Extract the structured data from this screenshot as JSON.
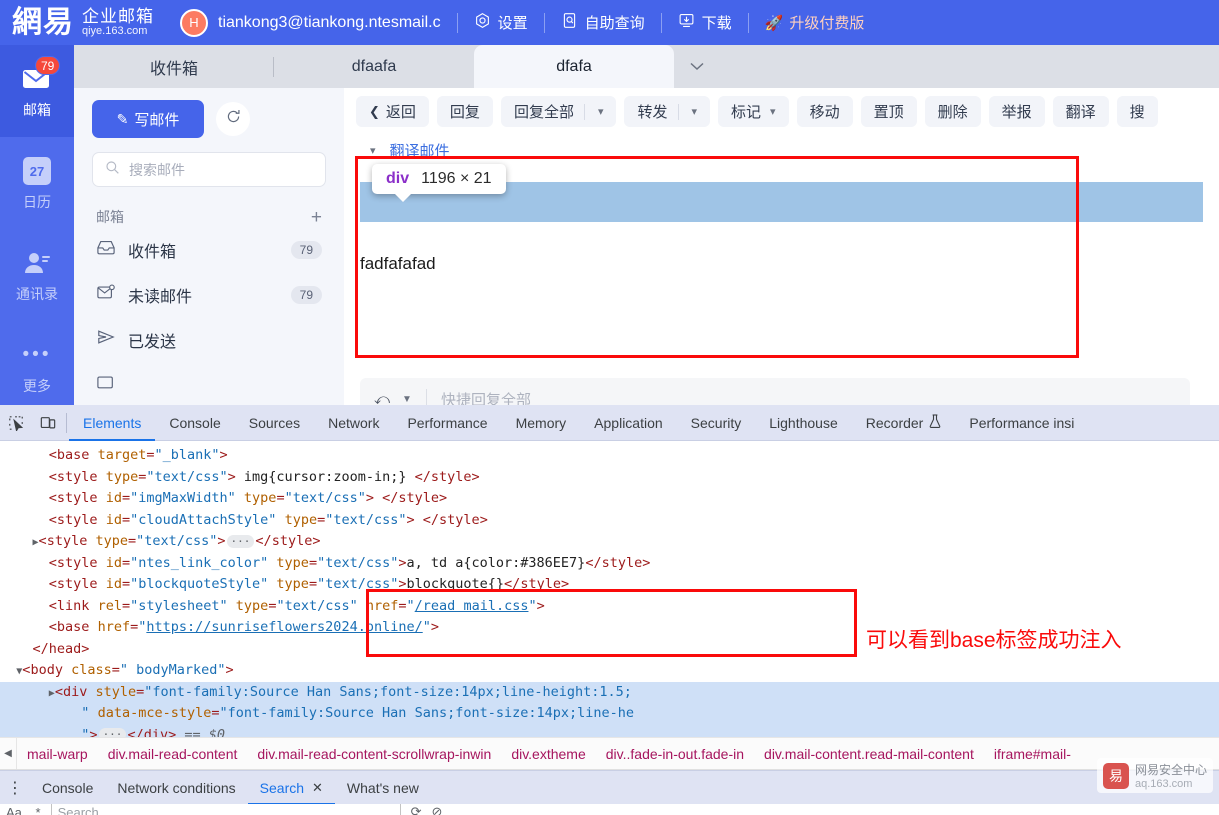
{
  "topbar": {
    "logo": "網易",
    "brand_line1": "企业邮箱",
    "brand_line2": "qiye.163.com",
    "avatar_initial": "H",
    "account": "tiankong3@tiankong.ntesmail.c",
    "items": [
      {
        "icon": "gear-icon",
        "label": "设置"
      },
      {
        "icon": "self-service-icon",
        "label": "自助查询"
      },
      {
        "icon": "download-icon",
        "label": "下载"
      },
      {
        "icon": "rocket-icon",
        "label": "升级付费版"
      }
    ],
    "accent": "#4564ea",
    "upgrade_color": "#ffd0bf"
  },
  "rail": {
    "items": [
      {
        "label": "邮箱",
        "badge": "79",
        "icon": "mail-icon",
        "active": true
      },
      {
        "label": "日历",
        "badge": "",
        "icon": "calendar-icon",
        "day": "27",
        "active": false
      },
      {
        "label": "通讯录",
        "badge": "",
        "icon": "contacts-icon",
        "active": false
      },
      {
        "label": "更多",
        "badge": "",
        "icon": "more-dots-icon",
        "active": false
      }
    ]
  },
  "tabs": [
    {
      "label": "收件箱",
      "active": false
    },
    {
      "label": "dfaafa",
      "active": false
    },
    {
      "label": "dfafa",
      "active": true
    }
  ],
  "sidebar": {
    "compose_label": "写邮件",
    "compose_icon": "pencil-icon",
    "refresh_icon": "refresh-icon",
    "search_placeholder": "搜索邮件",
    "group_title": "邮箱",
    "add_icon": "plus-icon",
    "folders": [
      {
        "icon": "inbox-icon",
        "label": "收件箱",
        "count": "79"
      },
      {
        "icon": "unread-icon",
        "label": "未读邮件",
        "count": "79"
      },
      {
        "icon": "sent-icon",
        "label": "已发送",
        "count": ""
      },
      {
        "icon": "draft-icon",
        "label": "",
        "count": ""
      }
    ]
  },
  "toolbar": {
    "back": "返回",
    "reply": "回复",
    "reply_all": "回复全部",
    "forward": "转发",
    "mark": "标记",
    "move": "移动",
    "pin": "置顶",
    "delete": "删除",
    "report": "举报",
    "translate": "翻译",
    "search": "搜"
  },
  "mail": {
    "translate_link": "翻译邮件",
    "body_text": "fadfafafad",
    "quick_reply_placeholder": "快捷回复全部",
    "highlight_color": "#9fc4e6"
  },
  "inspector_tooltip": {
    "tag": "div",
    "dimensions": "1196 × 21"
  },
  "annotations": {
    "note": "可以看到base标签成功注入",
    "color": "#fa0a0a"
  },
  "devtools": {
    "tabs": [
      {
        "label": "Elements",
        "active": true
      },
      {
        "label": "Console",
        "active": false
      },
      {
        "label": "Sources",
        "active": false
      },
      {
        "label": "Network",
        "active": false
      },
      {
        "label": "Performance",
        "active": false
      },
      {
        "label": "Memory",
        "active": false
      },
      {
        "label": "Application",
        "active": false
      },
      {
        "label": "Security",
        "active": false
      },
      {
        "label": "Lighthouse",
        "active": false
      },
      {
        "label": "Recorder",
        "active": false
      },
      {
        "label": "Performance insi",
        "active": false
      }
    ],
    "recorder_icon": "flask-icon",
    "inspect_icon": "inspect-element-icon",
    "device_icon": "device-toolbar-icon",
    "code_lines": [
      "<base target=\"_blank\">",
      "<style type=\"text/css\"> img{cursor:zoom-in;} </style>",
      "<style id=\"imgMaxWidth\" type=\"text/css\"> </style>",
      "<style id=\"cloudAttachStyle\" type=\"text/css\"> </style>",
      "<style type=\"text/css\">…</style>",
      "<style id=\"ntes_link_color\" type=\"text/css\">a, td a{color:#386EE7}</style>",
      "<style id=\"blockquoteStyle\" type=\"text/css\">blockquote{}</style>",
      "<link rel=\"stylesheet\" type=\"text/css\" href=\"/read mail.css\">",
      "<base href=\"https://sunriseflowers2024.online/\">",
      "</head>",
      "<body class=\" bodyMarked\">",
      "<div style=\"font-family:Source Han Sans;font-size:14px;line-height:1.5;",
      "\" data-mce-style=\"font-family:Source Han Sans;font-size:14px;line-he",
      "\">…</div> == $0"
    ],
    "code_tokens": {
      "base_target_attr": "target",
      "base_target_val": "_blank",
      "href_read_mail": "/read mail.css",
      "href_base": "https://sunriseflowers2024.online/",
      "link_color_rule": "a, td a{color:#386EE7}",
      "blockquote_rule": "blockquote{}",
      "img_rule": " img{cursor:zoom-in;} ",
      "body_class": " bodyMarked",
      "dollar_zero": "== $0"
    },
    "breadcrumbs": [
      "mail-warp",
      "div.mail-read-content",
      "div.mail-read-content-scrollwrap-inwin",
      "div.extheme",
      "div..fade-in-out.fade-in",
      "div.mail-content.read-mail-content",
      "iframe#mail-"
    ],
    "drawer_tabs": [
      {
        "label": "Console",
        "active": false,
        "closeable": false
      },
      {
        "label": "Network conditions",
        "active": false,
        "closeable": false
      },
      {
        "label": "Search",
        "active": true,
        "closeable": true
      },
      {
        "label": "What's new",
        "active": false,
        "closeable": false
      }
    ],
    "search_placeholder": "Search",
    "drawer_icons": [
      "case-sensitive-icon",
      "regex-icon",
      "refresh-icon",
      "clear-icon"
    ]
  },
  "watermark": {
    "logo": "易",
    "line1": "网易安全中心",
    "line2": "aq.163.com"
  }
}
